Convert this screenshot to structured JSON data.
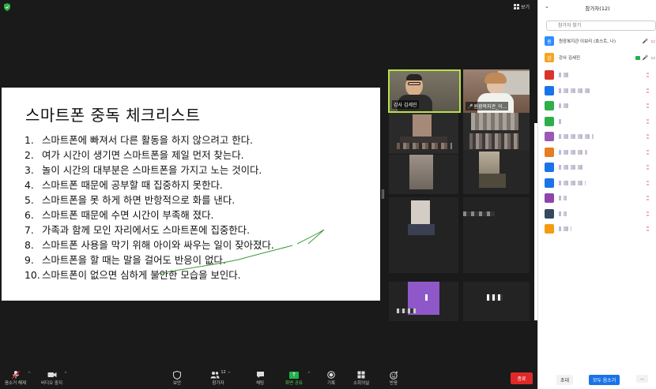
{
  "topbar": {
    "view_label": "보기"
  },
  "slide": {
    "title": "스마트폰 중독 체크리스트",
    "items": [
      {
        "num": "1.",
        "text": "스마트폰에 빠져서 다른 활동을 하지 않으려고 한다."
      },
      {
        "num": "2.",
        "text": "여가 시간이 생기면 스마트폰을 제일 먼저 찾는다."
      },
      {
        "num": "3.",
        "text": "놀이 시간의 대부분은 스마트폰을 가지고 노는 것이다."
      },
      {
        "num": "4.",
        "text": "스마트폰 때문에 공부할 때 집중하지 못한다."
      },
      {
        "num": "5.",
        "text": "스마트폰을 못 하게 하면 반항적으로 화를 낸다."
      },
      {
        "num": "6.",
        "text": "스마트폰 때문에 수면 시간이 부족해 졌다."
      },
      {
        "num": "7.",
        "text": "가족과 함께 모인 자리에서도 스마트폰에 집중한다."
      },
      {
        "num": "8.",
        "text": "스마트폰 사용을 막기 위해 아이와 싸우는 일이 잦아졌다."
      },
      {
        "num": "9.",
        "text": "스마트폰을 할 때는 말을 걸어도 반응이 없다."
      },
      {
        "num": "10.",
        "text": "스마트폰이 없으면 심하게 불안한 모습을 보인다."
      }
    ]
  },
  "videos": {
    "speaker": {
      "name": "강사 김세진"
    },
    "second": {
      "name": "원광복지관_이..."
    }
  },
  "toolbar": {
    "unmute": "음소거 해제",
    "video": "비디오 중지",
    "security": "보안",
    "participants": "참가자",
    "participants_count": "12",
    "chat": "채팅",
    "share": "화면 공유",
    "record": "기록",
    "breakout": "소회의실",
    "reactions": "반응",
    "end": "종료"
  },
  "panel": {
    "title": "참가자(12)",
    "search_placeholder": "참가자 찾기",
    "host": {
      "avatar": "원",
      "name": "원광복지관 이보리 (호스트, 나)",
      "color": "#2d8cff"
    },
    "cohost": {
      "avatar": "강",
      "name": "강사 김세진",
      "color": "#f5a623"
    },
    "others": [
      {
        "color": "#d9342b"
      },
      {
        "color": "#1a73e8"
      },
      {
        "color": "#2eaf4a"
      },
      {
        "color": "#2eaf4a"
      },
      {
        "color": "#9b59b6"
      },
      {
        "color": "#e67e22"
      },
      {
        "color": "#1a73e8"
      },
      {
        "color": "#1a73e8"
      },
      {
        "color": "#8e44ad"
      },
      {
        "color": "#34495e"
      },
      {
        "color": "#f39c12"
      }
    ],
    "invite": "초대",
    "mute_all": "모두 음소거",
    "more": "..."
  }
}
